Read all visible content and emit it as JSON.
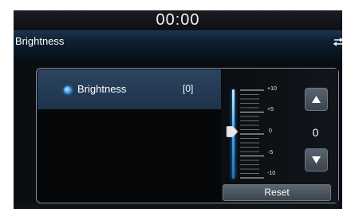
{
  "status_bar": {
    "clock": "00:00"
  },
  "header": {
    "title": "Brightness",
    "back_icon": "back-return-icon"
  },
  "settings_list": {
    "items": [
      {
        "label": "Brightness",
        "value": "[0]",
        "selected": true
      }
    ]
  },
  "brightness_slider": {
    "scale_labels": [
      "+10",
      "+5",
      "0",
      "-5",
      "-10"
    ],
    "current_value": 0,
    "min": -10,
    "max": 10
  },
  "controls": {
    "up_icon": "triangle-up-icon",
    "down_icon": "triangle-down-icon",
    "value_display": "0",
    "reset_label": "Reset"
  },
  "colors": {
    "accent_blue": "#3aa7f0",
    "header_blue": "#1d3550",
    "selected_row": "#2c4460"
  }
}
